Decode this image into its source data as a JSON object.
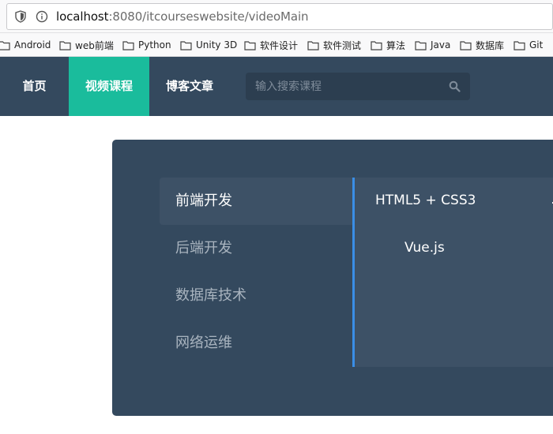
{
  "browser": {
    "url_host": "localhost",
    "url_rest": ":8080/itcourseswebsite/videoMain",
    "bookmarks": [
      {
        "label": "Android"
      },
      {
        "label": "web前端"
      },
      {
        "label": "Python"
      },
      {
        "label": "Unity 3D"
      },
      {
        "label": "软件设计"
      },
      {
        "label": "软件测试"
      },
      {
        "label": "算法"
      },
      {
        "label": "Java"
      },
      {
        "label": "数据库"
      },
      {
        "label": "Git"
      }
    ]
  },
  "nav": {
    "items": [
      {
        "label": "首页"
      },
      {
        "label": "视频课程"
      },
      {
        "label": "博客文章"
      }
    ],
    "active_index": 1,
    "search_placeholder": "输入搜索课程"
  },
  "courses": {
    "categories": [
      {
        "label": "前端开发"
      },
      {
        "label": "后端开发"
      },
      {
        "label": "数据库技术"
      },
      {
        "label": "网络运维"
      }
    ],
    "active_category": 0,
    "subcourses": [
      {
        "label": "HTML5 + CSS3"
      },
      {
        "label": "Vue.js"
      }
    ]
  },
  "colors": {
    "nav_bg": "#34495e",
    "nav_active": "#1abc9c",
    "panel_bg": "#34495e",
    "panel_active": "#3d5166",
    "accent_border": "#3a8ee6"
  },
  "icons": {
    "url_security": "shield-icon",
    "url_info": "info-icon",
    "bookmark": "folder-icon",
    "search": "search-icon"
  }
}
